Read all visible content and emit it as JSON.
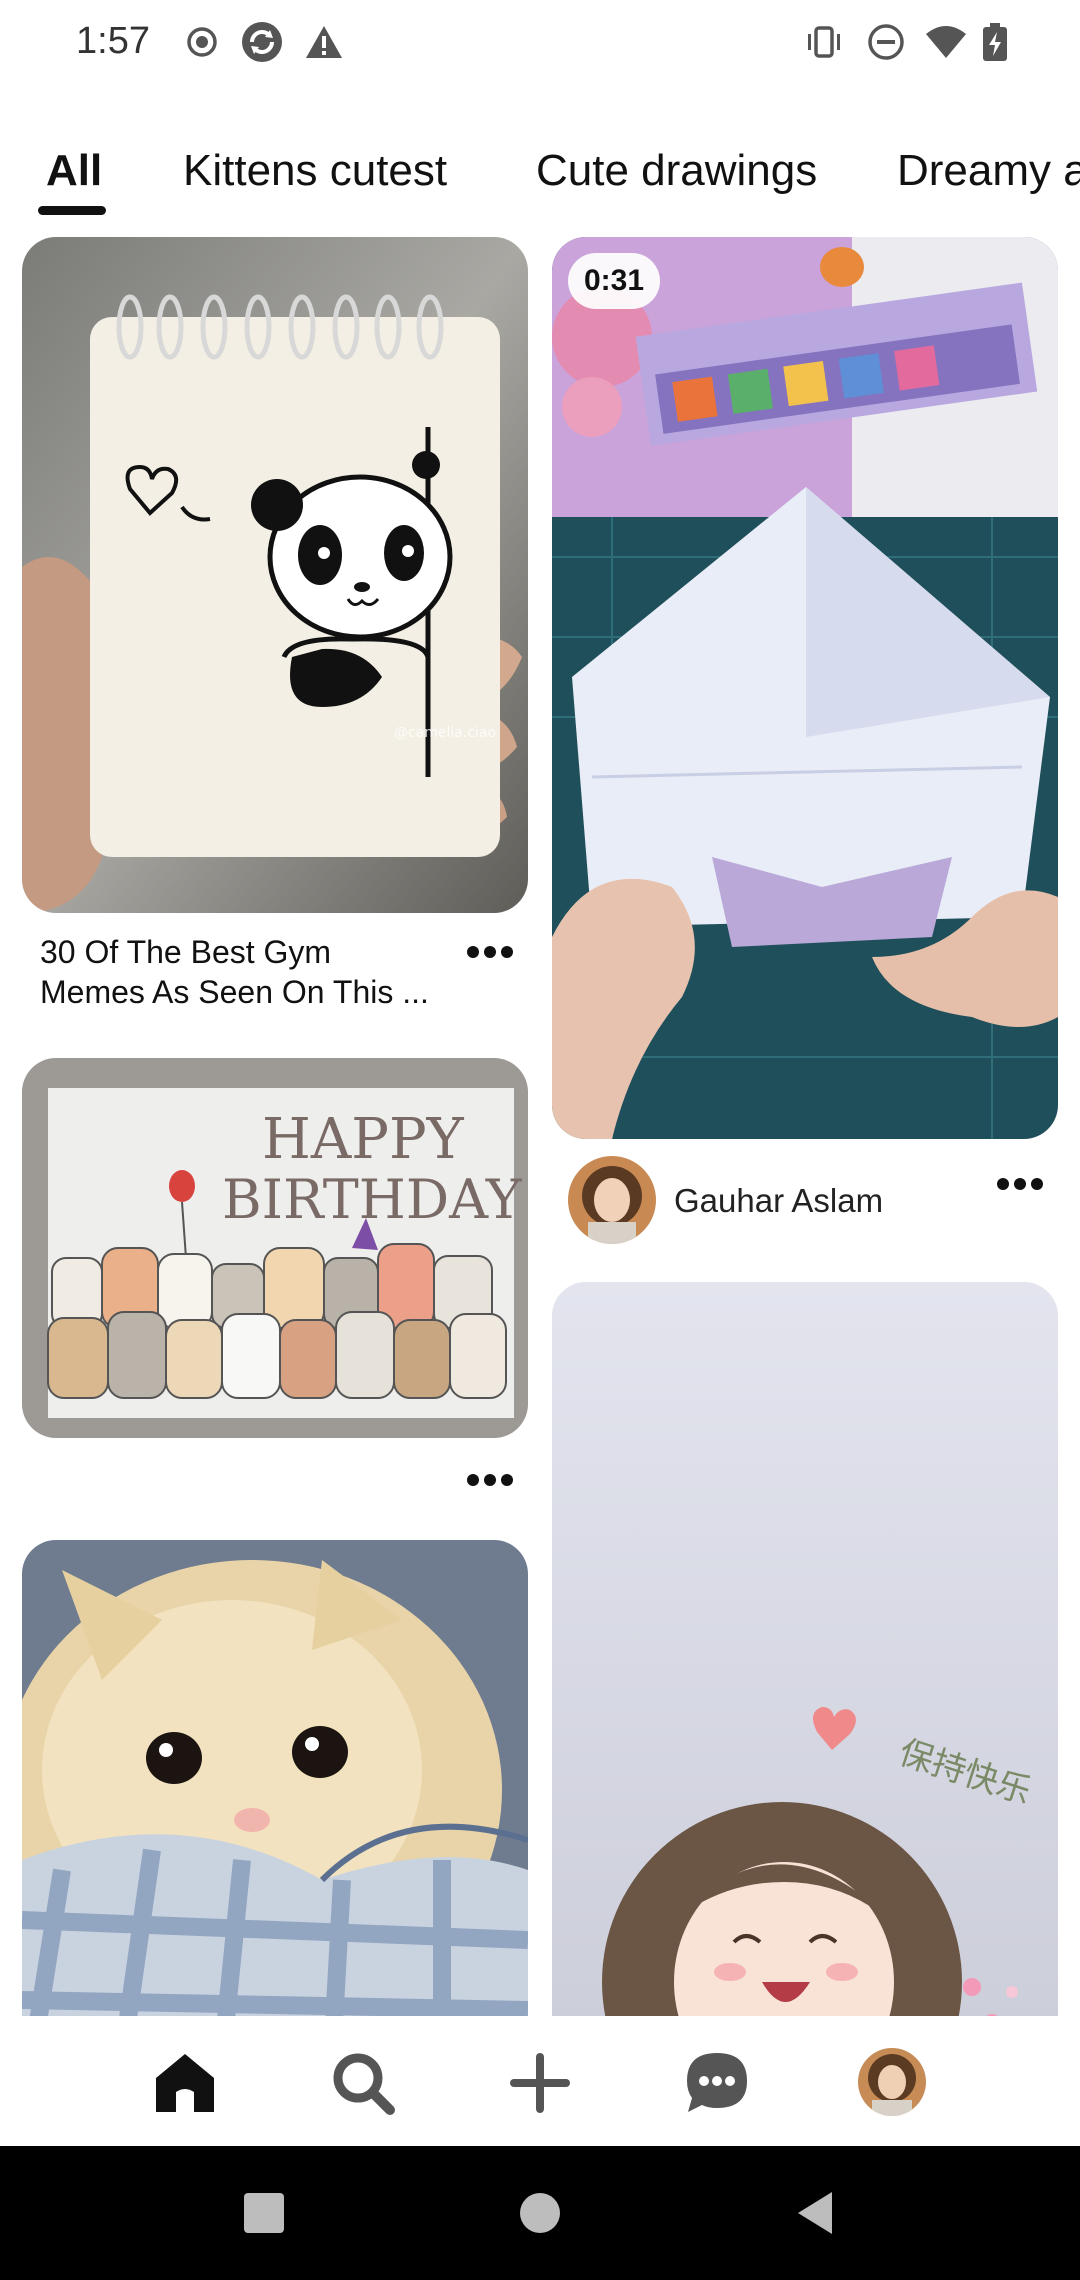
{
  "status_bar": {
    "time": "1:57",
    "left_icons": [
      "record-icon",
      "sync-icon",
      "warning-icon"
    ],
    "right_icons": [
      "vibrate-icon",
      "do-not-disturb-icon",
      "wifi-icon",
      "battery-charging-icon"
    ]
  },
  "tabs": [
    {
      "label": "All",
      "active": true
    },
    {
      "label": "Kittens cutest",
      "active": false
    },
    {
      "label": "Cute drawings",
      "active": false
    },
    {
      "label": "Dreamy a",
      "active": false
    }
  ],
  "feed": {
    "pins": [
      {
        "id": "panda-notebook",
        "title_line1": "30 Of The Best Gym",
        "title_line2": "Memes As Seen On This ...",
        "watermark": "@camelia.ciao"
      },
      {
        "id": "paper-fold-video",
        "duration": "0:31",
        "creator": "Gauhar Aslam"
      },
      {
        "id": "birthday-card",
        "card_text_line1": "HAPPY",
        "card_text_line2": "BIRTHDAY"
      },
      {
        "id": "anime-girl",
        "caption": "保持快乐"
      },
      {
        "id": "kitten-blanket"
      }
    ]
  },
  "bottom_nav": {
    "items": [
      "home-icon",
      "search-icon",
      "create-icon",
      "messages-icon",
      "profile-avatar"
    ],
    "active": "home-icon"
  },
  "system_nav": {
    "items": [
      "recents-button",
      "home-button",
      "back-button"
    ]
  },
  "colors": {
    "text": "#111111",
    "background": "#ffffff",
    "system_nav": "#000000"
  }
}
